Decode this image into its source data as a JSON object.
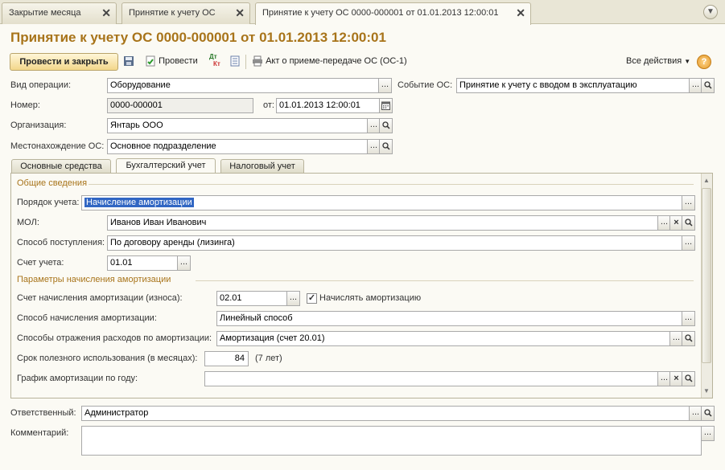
{
  "window_tabs": [
    {
      "label": "Закрытие месяца",
      "active": false
    },
    {
      "label": "Принятие к учету ОС",
      "active": false
    },
    {
      "label": "Принятие к учету ОС 0000-000001 от 01.01.2013 12:00:01",
      "active": true
    }
  ],
  "title": "Принятие к учету ОС 0000-000001 от 01.01.2013 12:00:01",
  "toolbar": {
    "post_close_label": "Провести и закрыть",
    "post_label": "Провести",
    "dt_kt_label": "Дт\nКт",
    "act_label": "Акт о приеме-передаче ОС (ОС-1)",
    "all_actions_label": "Все действия",
    "help_label": "?"
  },
  "header": {
    "operation_type_label": "Вид операции:",
    "operation_type_value": "Оборудование",
    "event_label": "Событие ОС:",
    "event_value": "Принятие к учету с вводом в эксплуатацию",
    "number_label": "Номер:",
    "number_value": "0000-000001",
    "date_label": "от:",
    "date_value": "01.01.2013 12:00:01",
    "org_label": "Организация:",
    "org_value": "Янтарь ООО",
    "location_label": "Местонахождение ОС:",
    "location_value": "Основное подразделение"
  },
  "inner_tabs": [
    {
      "label": "Основные средства",
      "active": false
    },
    {
      "label": "Бухгалтерский учет",
      "active": true
    },
    {
      "label": "Налоговый учет",
      "active": false
    }
  ],
  "accounting": {
    "general_group": "Общие сведения",
    "order_label": "Порядок учета:",
    "order_value": "Начисление амортизации",
    "mol_label": "МОЛ:",
    "mol_value": "Иванов Иван Иванович",
    "receipt_label": "Способ поступления:",
    "receipt_value": "По договору аренды (лизинга)",
    "account_label": "Счет учета:",
    "account_value": "01.01",
    "depr_group": "Параметры начисления амортизации",
    "depr_account_label": "Счет начисления амортизации (износа):",
    "depr_account_value": "02.01",
    "accrue_label": "Начислять амортизацию",
    "accrue_checked": true,
    "depr_method_label": "Способ начисления амортизации:",
    "depr_method_value": "Линейный способ",
    "expense_label": "Способы отражения расходов по амортизации:",
    "expense_value": "Амортизация (счет 20.01)",
    "useful_life_label": "Срок полезного использования (в месяцах):",
    "useful_life_value": "84",
    "useful_life_years": "(7 лет)",
    "schedule_label": "График амортизации по году:",
    "schedule_value": ""
  },
  "footer": {
    "responsible_label": "Ответственный:",
    "responsible_value": "Администратор",
    "comment_label": "Комментарий:",
    "comment_value": ""
  },
  "icons": {
    "select": "...",
    "search": "search-icon",
    "clear": "×",
    "calendar": "calendar-icon"
  }
}
